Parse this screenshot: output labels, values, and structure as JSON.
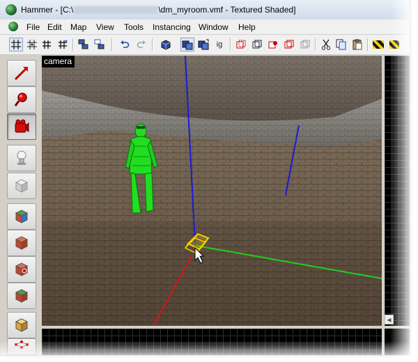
{
  "window": {
    "title_prefix": "Hammer - [C:\\",
    "title_suffix": "\\dm_myroom.vmf - Textured Shaded]"
  },
  "menu": {
    "items": [
      "File",
      "Edit",
      "Map",
      "View",
      "Tools",
      "Instancing",
      "Window",
      "Help"
    ]
  },
  "toolbar": {
    "icons": [
      "grid-icon",
      "grid-toggle-icon",
      "grid-smaller-icon",
      "grid-larger-icon",
      "group-icon",
      "ungroup-icon",
      "undo-icon",
      "redo-icon",
      "carve-icon",
      "texture-lock-icon",
      "texture-lock-scale-icon",
      "ignore-groups-label",
      "hide-icon",
      "show-icon",
      "cordon-icon",
      "visgroup-icon",
      "visgroup-apply-icon",
      "cut-icon",
      "copy-icon",
      "paste-icon",
      "hazard-icon",
      "hazard-alt-icon"
    ],
    "ig_label": "ig"
  },
  "tools": {
    "icons": [
      "selection-tool-icon",
      "magnify-tool-icon",
      "camera-tool-icon",
      "entity-tool-icon",
      "block-tool-icon",
      "texture-application-icon",
      "apply-texture-icon",
      "decal-tool-icon",
      "overlay-tool-icon",
      "clipping-tool-icon",
      "vertex-tool-icon"
    ]
  },
  "viewport": {
    "label": "camera"
  },
  "colors": {
    "axis_x": "#d01818",
    "axis_y": "#20d020",
    "axis_z": "#1a1ad8",
    "player_model": "#22dd22",
    "selection": "#f5d000"
  }
}
